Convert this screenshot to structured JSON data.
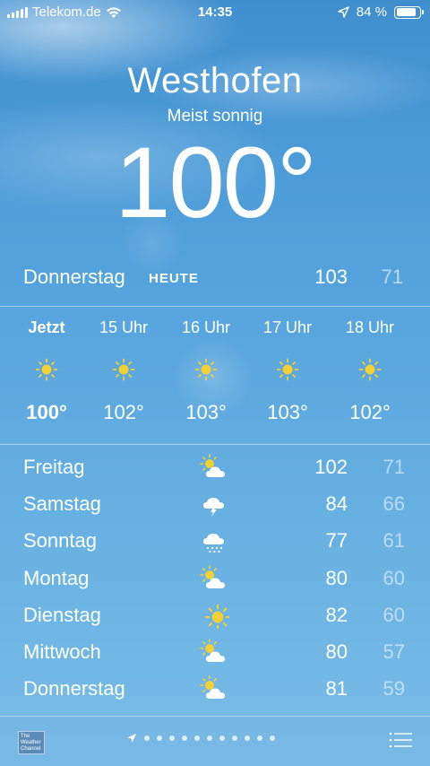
{
  "status_bar": {
    "carrier": "Telekom.de",
    "time": "14:35",
    "battery": "84 %",
    "battery_level": 0.84
  },
  "location": {
    "city": "Westhofen",
    "condition": "Meist sonnig",
    "temperature": "100°"
  },
  "today": {
    "day": "Donnerstag",
    "label": "HEUTE",
    "high": "103",
    "low": "71"
  },
  "hourly": [
    {
      "time": "Jetzt",
      "icon": "sun-icon",
      "temp": "100°"
    },
    {
      "time": "15 Uhr",
      "icon": "sun-icon",
      "temp": "102°"
    },
    {
      "time": "16 Uhr",
      "icon": "sun-icon",
      "temp": "103°"
    },
    {
      "time": "17 Uhr",
      "icon": "sun-icon",
      "temp": "103°"
    },
    {
      "time": "18 Uhr",
      "icon": "sun-icon",
      "temp": "102°"
    }
  ],
  "daily": [
    {
      "day": "Freitag",
      "icon": "partly-cloudy-icon",
      "high": "102",
      "low": "71"
    },
    {
      "day": "Samstag",
      "icon": "thunderstorm-icon",
      "high": "84",
      "low": "66"
    },
    {
      "day": "Sonntag",
      "icon": "rain-icon",
      "high": "77",
      "low": "61"
    },
    {
      "day": "Montag",
      "icon": "partly-cloudy-icon",
      "high": "80",
      "low": "60"
    },
    {
      "day": "Dienstag",
      "icon": "sun-icon",
      "high": "82",
      "low": "60"
    },
    {
      "day": "Mittwoch",
      "icon": "partly-cloudy-icon",
      "high": "80",
      "low": "57"
    },
    {
      "day": "Donnerstag",
      "icon": "partly-cloudy-icon",
      "high": "81",
      "low": "59"
    }
  ],
  "toolbar": {
    "logo_text": "The Weather Channel",
    "page_count": 12,
    "icons": [
      "location-arrow-icon",
      "list-icon"
    ]
  },
  "colors": {
    "sun": "#f5d033",
    "sky_top": "#3f8fcf",
    "sky_bottom": "#79bde6"
  }
}
